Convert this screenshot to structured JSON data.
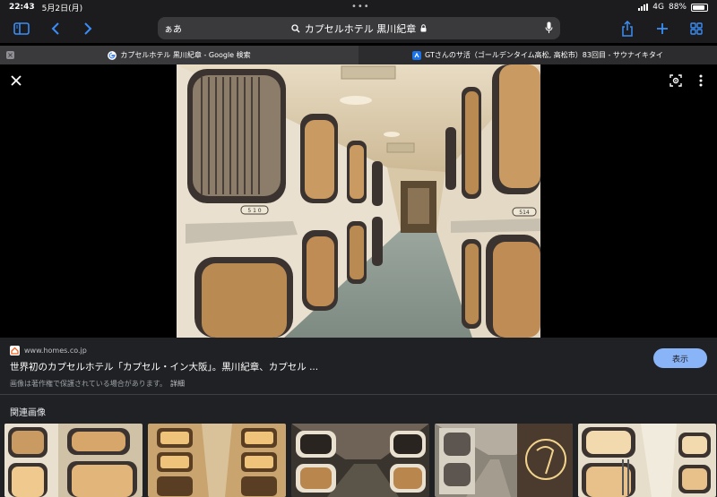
{
  "status": {
    "time": "22:43",
    "date": "5月2日(月)",
    "network": "4G",
    "battery": "88%",
    "battery_level": 0.88
  },
  "toolbar": {
    "reader": "ぁあ",
    "url": "カプセルホテル 黒川紀章"
  },
  "tabs": [
    {
      "label": "カプセルホテル 黒川紀章 - Google 検索",
      "active": true
    },
    {
      "label": "GTさんのサ活（ゴールデンタイム高松, 高松市）83回目 - サウナイキタイ",
      "active": false
    }
  ],
  "result": {
    "source": "www.homes.co.jp",
    "title": "世界初のカプセルホテル「カプセル・イン大阪」。黒川紀章、カプセル ...",
    "copyright_note": "画像は著作権で保護されている場合があります。",
    "details_link": "詳細",
    "view_button": "表示"
  },
  "related": {
    "heading": "関連画像"
  },
  "photo": {
    "room_label_1": "5 1 0",
    "room_label_2": "514"
  },
  "icons": {
    "sidebar": "sidebar-icon",
    "back": "chevron-left-icon",
    "forward": "chevron-right-icon",
    "search": "search-icon",
    "lock": "lock-icon",
    "mic": "microphone-icon",
    "share": "share-icon",
    "new_tab": "plus-icon",
    "tabs": "tabs-grid-icon",
    "close": "close-icon",
    "lens": "lens-icon",
    "more": "more-vert-icon"
  },
  "colors": {
    "accent": "#3a8ef6",
    "view_button": "#8ab4f8",
    "panel": "#202124"
  }
}
